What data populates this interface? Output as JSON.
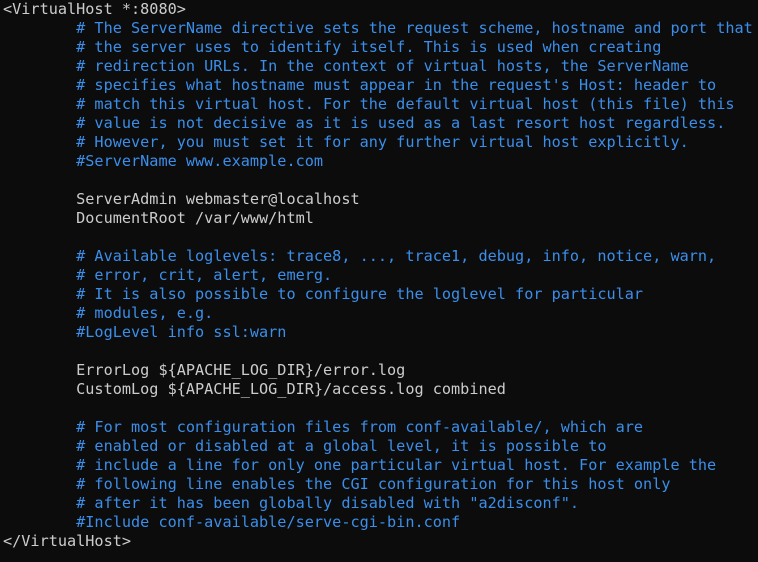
{
  "colors": {
    "background": "#0c0c0c",
    "default_text": "#cccccc",
    "comment": "#3b8eea"
  },
  "lines": [
    {
      "text": "<VirtualHost *:8080>",
      "kind": "directive"
    },
    {
      "text": "        # The ServerName directive sets the request scheme, hostname and port that",
      "kind": "comment"
    },
    {
      "text": "        # the server uses to identify itself. This is used when creating",
      "kind": "comment"
    },
    {
      "text": "        # redirection URLs. In the context of virtual hosts, the ServerName",
      "kind": "comment"
    },
    {
      "text": "        # specifies what hostname must appear in the request's Host: header to",
      "kind": "comment"
    },
    {
      "text": "        # match this virtual host. For the default virtual host (this file) this",
      "kind": "comment"
    },
    {
      "text": "        # value is not decisive as it is used as a last resort host regardless.",
      "kind": "comment"
    },
    {
      "text": "        # However, you must set it for any further virtual host explicitly.",
      "kind": "comment"
    },
    {
      "text": "        #ServerName www.example.com",
      "kind": "comment"
    },
    {
      "text": "",
      "kind": "blank"
    },
    {
      "text": "        ServerAdmin webmaster@localhost",
      "kind": "directive"
    },
    {
      "text": "        DocumentRoot /var/www/html",
      "kind": "directive"
    },
    {
      "text": "",
      "kind": "blank"
    },
    {
      "text": "        # Available loglevels: trace8, ..., trace1, debug, info, notice, warn,",
      "kind": "comment"
    },
    {
      "text": "        # error, crit, alert, emerg.",
      "kind": "comment"
    },
    {
      "text": "        # It is also possible to configure the loglevel for particular",
      "kind": "comment"
    },
    {
      "text": "        # modules, e.g.",
      "kind": "comment"
    },
    {
      "text": "        #LogLevel info ssl:warn",
      "kind": "comment"
    },
    {
      "text": "",
      "kind": "blank"
    },
    {
      "text": "        ErrorLog ${APACHE_LOG_DIR}/error.log",
      "kind": "directive"
    },
    {
      "text": "        CustomLog ${APACHE_LOG_DIR}/access.log combined",
      "kind": "directive"
    },
    {
      "text": "",
      "kind": "blank"
    },
    {
      "text": "        # For most configuration files from conf-available/, which are",
      "kind": "comment"
    },
    {
      "text": "        # enabled or disabled at a global level, it is possible to",
      "kind": "comment"
    },
    {
      "text": "        # include a line for only one particular virtual host. For example the",
      "kind": "comment"
    },
    {
      "text": "        # following line enables the CGI configuration for this host only",
      "kind": "comment"
    },
    {
      "text": "        # after it has been globally disabled with \"a2disconf\".",
      "kind": "comment"
    },
    {
      "text": "        #Include conf-available/serve-cgi-bin.conf",
      "kind": "comment"
    },
    {
      "text": "</VirtualHost>",
      "kind": "directive"
    }
  ]
}
